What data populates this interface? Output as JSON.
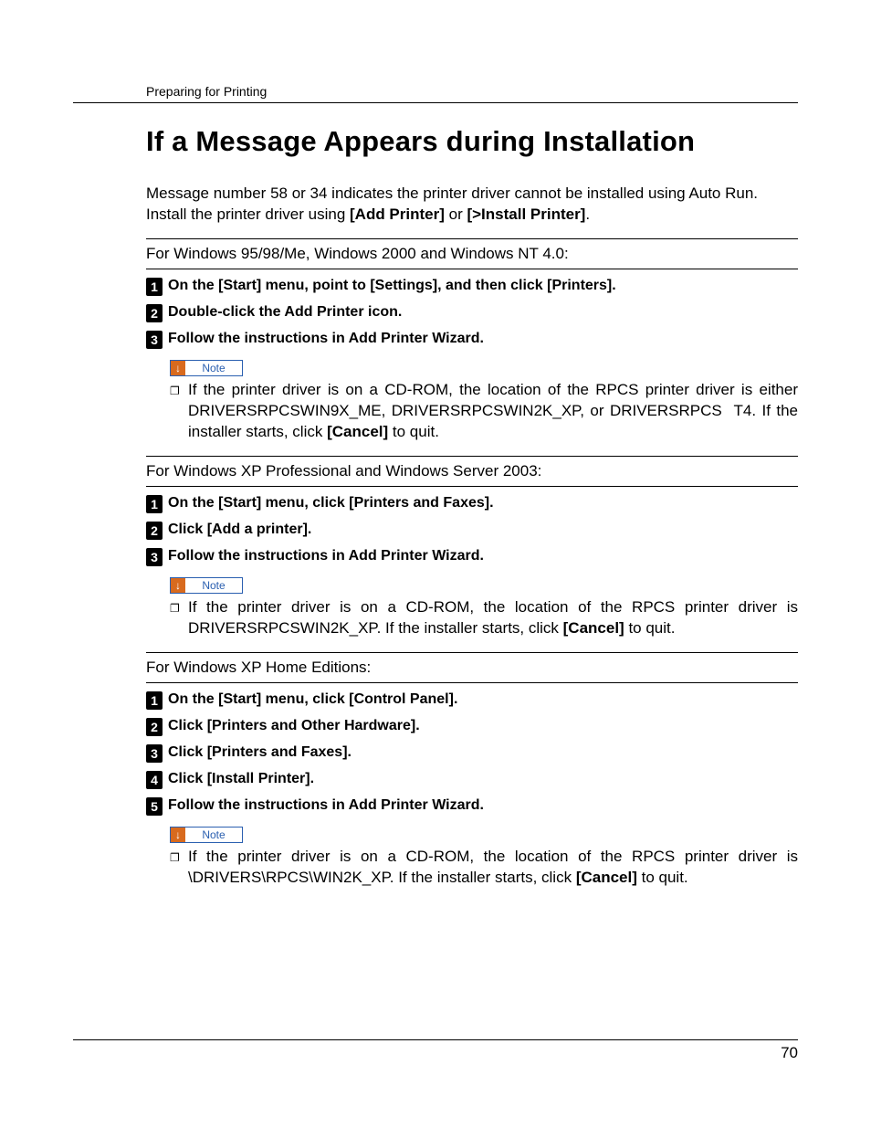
{
  "running_head": "Preparing for Printing",
  "title": "If a Message Appears during Installation",
  "intro_html": "Message number 58 or 34 indicates the printer driver cannot be installed using Auto Run. Install the printer driver using <b>[Add Printer]</b> or <b>[>Install Printer]</b>.",
  "sections": [
    {
      "heading": "For Windows 95/98/Me, Windows 2000 and Windows NT 4.0:",
      "steps": [
        "On the <b>[Start]</b> menu, point to <b>[Settings]</b>, and then click <b>[Printers]</b>.",
        "Double-click the Add Printer icon.",
        "Follow the instructions in Add Printer Wizard."
      ],
      "note_label": "Note",
      "note_html": "If the printer driver is on a CD-ROM, the location of the RPCS printer driver is either DRIVERSRPCSWIN9X_ME, DRIVERSRPCSWIN2K_XP, or DRIVERSRPCS  T4. If the installer starts, click <b>[Cancel]</b> to quit."
    },
    {
      "heading": "For Windows XP Professional and Windows Server 2003:",
      "steps": [
        "On the <b>[Start]</b> menu, click <b>[Printers and Faxes]</b>.",
        "Click <b>[Add a printer]</b>.",
        "Follow the instructions in Add Printer Wizard."
      ],
      "note_label": "Note",
      "note_html": "If the printer driver is on a CD-ROM, the location of the RPCS printer driver is DRIVERSRPCSWIN2K_XP. If the installer starts, click <b>[Cancel]</b> to quit."
    },
    {
      "heading": "For Windows XP Home Editions:",
      "steps": [
        "On the <b>[Start]</b> menu, click <b>[Control Panel]</b>.",
        "Click <b>[Printers and Other Hardware]</b>.",
        "Click <b>[Printers and Faxes]</b>.",
        "Click <b>[Install Printer]</b>.",
        "Follow the instructions in Add Printer Wizard."
      ],
      "note_label": "Note",
      "note_html": "If the printer driver is on a CD-ROM, the location of the RPCS printer driver is \\DRIVERS\\RPCS\\WIN2K_XP. If the installer starts, click <b>[Cancel]</b> to quit."
    }
  ],
  "page_number": "70"
}
